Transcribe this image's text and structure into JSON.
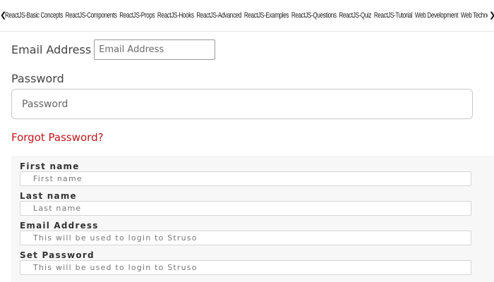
{
  "topnav": {
    "left_arrow": "❮",
    "right_arrow": "❯",
    "items": [
      "ReactJS-Basic Concepts",
      "ReactJS-Components",
      "ReactJS-Props",
      "ReactJS-Hooks",
      "ReactJS-Advanced",
      "ReactJS-Examples",
      "ReactJS-Questions",
      "ReactJS-Quiz",
      "ReactJS-Tutorial",
      "Web Development",
      "Web Technology"
    ]
  },
  "login": {
    "email_label": "Email Address",
    "email_placeholder": "Email Address",
    "password_label": "Password",
    "password_placeholder": "Password",
    "forgot_link": "Forgot Password?"
  },
  "signup": {
    "first_name_label": "First name",
    "first_name_placeholder": "First name",
    "last_name_label": "Last name",
    "last_name_placeholder": "Last name",
    "email_label": "Email Address",
    "email_placeholder": "This will be used to login to Struso",
    "password_label": "Set Password",
    "password_placeholder": "This will be used to login to Struso"
  },
  "colors": {
    "link_red": "#c4161c",
    "panel_bg": "#f7f7f7"
  }
}
